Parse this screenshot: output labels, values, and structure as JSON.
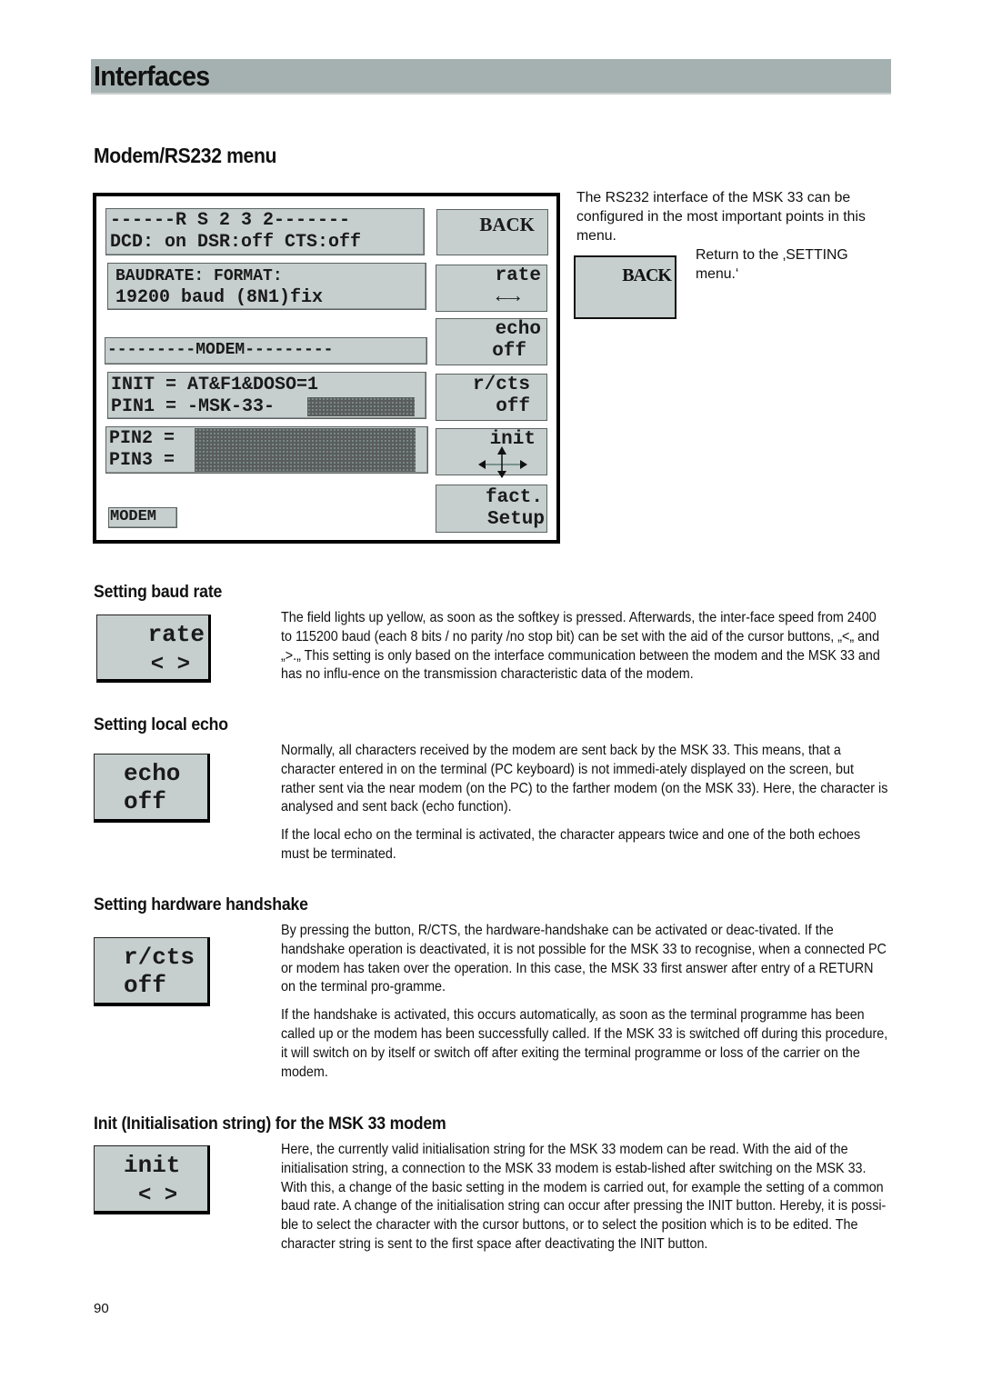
{
  "page": {
    "header_title": "Interfaces",
    "section_title": "Modem/RS232 menu",
    "page_number": "90"
  },
  "screen": {
    "rs232_line1": "------R S 2 3 2-------",
    "rs232_line2": "DCD: on DSR:off CTS:off",
    "baud_line1": "BAUDRATE:    FORMAT:",
    "baud_line2": "19200 baud  (8N1)fix",
    "modem_divider": "---------MODEM---------",
    "init_line": "INIT = AT&F1&DOSO=1",
    "pin1_line": "PIN1 = -MSK-33-",
    "pin2_line": "PIN2 =",
    "pin3_line": "PIN3 =",
    "mode_tag": "MODEM",
    "softkeys": [
      {
        "line1": "BACK",
        "line2": ""
      },
      {
        "line1": "rate",
        "line2": "←→",
        "icon": "left-right-arrows-icon"
      },
      {
        "line1": "echo",
        "line2": "off"
      },
      {
        "line1": "r/cts",
        "line2": "off"
      },
      {
        "line1": "init",
        "line2": "",
        "icon": "four-way-arrows-icon"
      },
      {
        "line1": "fact.",
        "line2": "Setup"
      }
    ]
  },
  "intro": {
    "text": "The RS232 interface of the MSK 33 can be configured in the most important points in this menu.",
    "back_key": "BACK",
    "back_text": "Return to the ‚SETTING menu.‘"
  },
  "sections": [
    {
      "heading": "Setting baud rate",
      "key_line1": "rate",
      "key_line2": "< >",
      "paragraphs": [
        "The field lights up yellow, as soon as the softkey is pressed. Afterwards, the inter-face speed from 2400 to 115200 baud (each 8 bits / no parity /no stop bit) can be set with the aid of the cursor buttons, „<„ and „>.„  This setting is only based on the interface communication between the modem and the MSK 33 and has no influ-ence on the transmission characteristic data of the modem."
      ]
    },
    {
      "heading": "Setting local echo",
      "key_line1": "echo",
      "key_line2": "off",
      "paragraphs": [
        "Normally, all characters received by the modem are sent back by the MSK 33. This means, that a character entered in on the terminal (PC keyboard) is not immedi-ately displayed on the screen, but rather sent via the near modem (on the PC) to the farther modem (on the MSK 33).  Here, the character is analysed and sent back (echo function).",
        "If the local echo on the terminal is activated, the character appears twice and one of the both echoes must be terminated."
      ]
    },
    {
      "heading": "Setting hardware handshake",
      "key_line1": "r/cts",
      "key_line2": "off",
      "paragraphs": [
        "By pressing the button, R/CTS, the hardware-handshake can be activated or deac-tivated. If the handshake operation is deactivated, it is not possible for the MSK 33 to recognise, when a connected PC or modem has taken over the operation. In this case, the MSK 33 first answer after entry of a RETURN on the terminal pro-gramme.",
        "If the handshake is activated, this occurs automatically, as soon as the terminal programme has been called up or the modem has been successfully called. If the MSK 33 is switched off during this procedure, it will switch on by itself or switch off after exiting the terminal programme or loss of the carrier on the modem."
      ]
    },
    {
      "heading": "Init (Initialisation string) for the MSK 33 modem",
      "key_line1": "init",
      "key_line2": "< >",
      "paragraphs": [
        "Here, the currently valid initialisation string for the MSK 33 modem can be read. With the aid of the initialisation string, a connection to the MSK 33 modem is estab-lished after switching on the MSK 33.  With this, a change of the basic setting in the modem is carried out, for example the setting of a common baud rate. A change of the initialisation string can occur after pressing the INIT button. Hereby, it is possi-ble to select the character with the cursor buttons, or to select the position which is to be edited. The character string is sent to the first space after deactivating the INIT button."
      ]
    }
  ]
}
